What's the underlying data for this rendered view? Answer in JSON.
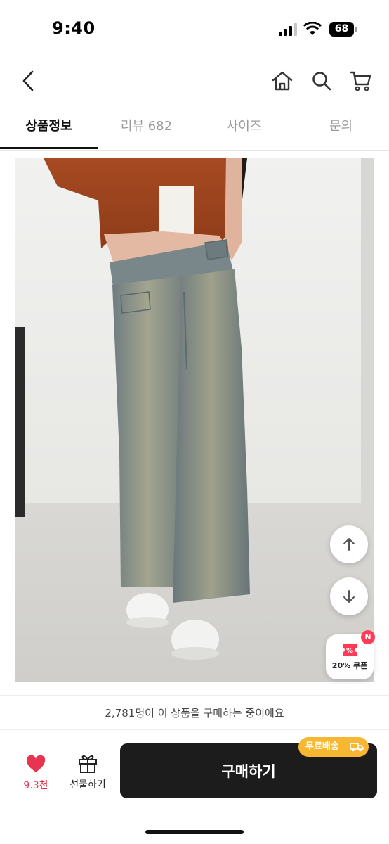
{
  "status_bar": {
    "time": "9:40",
    "battery": "68"
  },
  "header": {
    "back": "back",
    "icons": [
      "home-icon",
      "search-icon",
      "cart-icon"
    ]
  },
  "tabs": [
    {
      "label": "상품정보",
      "active": true
    },
    {
      "label": "리뷰 682",
      "active": false
    },
    {
      "label": "사이즈",
      "active": false
    },
    {
      "label": "문의",
      "active": false
    }
  ],
  "floating": {
    "coupon_label": "20% 쿠폰",
    "coupon_badge": "N"
  },
  "notice": {
    "text": "2,781명이 이 상품을 구매하는 중이에요"
  },
  "bottom": {
    "like_count": "9.3천",
    "gift_label": "선물하기",
    "buy_label": "구매하기",
    "shipping_badge": "무료배송"
  },
  "colors": {
    "accent_red": "#e8344e",
    "buy_button": "#1c1c1c",
    "shipping_badge": "#f7b731"
  }
}
